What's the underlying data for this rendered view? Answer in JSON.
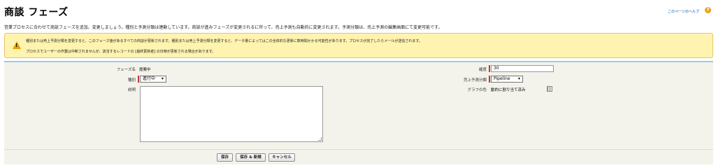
{
  "header": {
    "title": "商談 フェーズ",
    "help_link": "このページのヘルプ",
    "help_icon": "question-icon"
  },
  "description": "営業プロセスに合わせて商談フェーズを追加、変更しましょう。種別と予測分類は連動しています。商談が進みフェーズが変更されるに伴って、売上予測も自動的に変更されます。予測分類は、売上予測の編集画面にて変更可能です。",
  "warning": {
    "icon": "warning-icon",
    "line1": "種別または売上予測分類を変更すると、このフェーズ値があるすべての商談が更新されます。種別または売上予測分類を変更すると、データ量によってはこの全体的な更新に数時間かかる可能性があります。プロセスが完了したらメールが送信されます。",
    "line2": "プロセスでユーザーの作業は中断されませんが、該当するレコードの [最終更新者] の日時が更新される場合があります。"
  },
  "form": {
    "phase_name_label": "フェーズ名",
    "phase_name_value": "提案中",
    "type_label": "種別",
    "type_value": "進行中",
    "description_label": "説明",
    "description_value": "",
    "probability_label": "確度",
    "probability_value": "30",
    "forecast_label": "売上予測分類",
    "forecast_value": "Pipeline",
    "graph_color_label": "グラフの色",
    "graph_color_value": "動的に割り当て済み"
  },
  "buttons": {
    "save": "保存",
    "save_new": "保存 & 新規",
    "cancel": "キャンセル"
  },
  "colors": {
    "required": "#c23934",
    "warning_bg": "#fff3b0",
    "panel_bg": "#f3f3ec",
    "panel_border": "#9ec8e0"
  }
}
